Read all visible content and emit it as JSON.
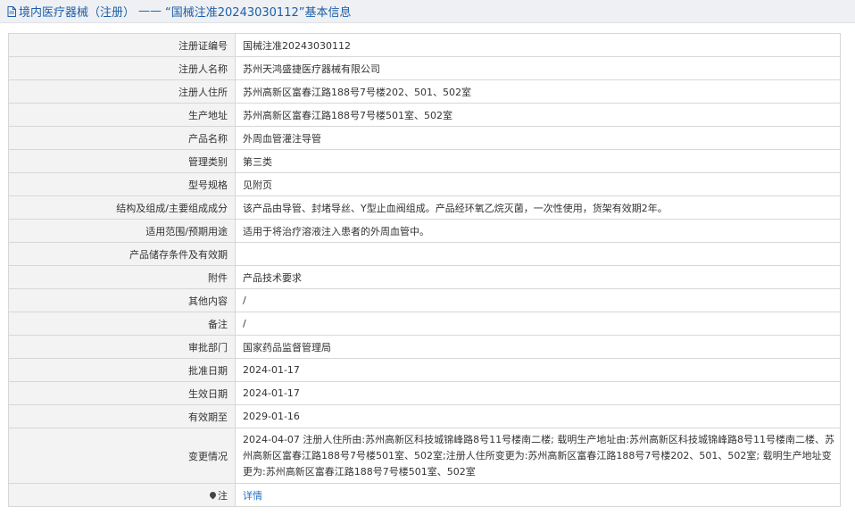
{
  "header": {
    "category": "境内医疗器械（注册）",
    "separator": "——",
    "title": "“国械注准20243030112”基本信息",
    "accent": "#1d5ea8"
  },
  "rows": [
    {
      "label": "注册证编号",
      "value": "国械注准20243030112"
    },
    {
      "label": "注册人名称",
      "value": "苏州天鸿盛捷医疗器械有限公司"
    },
    {
      "label": "注册人住所",
      "value": "苏州高新区富春江路188号7号楼202、501、502室"
    },
    {
      "label": "生产地址",
      "value": "苏州高新区富春江路188号7号楼501室、502室"
    },
    {
      "label": "产品名称",
      "value": "外周血管灌注导管"
    },
    {
      "label": "管理类别",
      "value": "第三类"
    },
    {
      "label": "型号规格",
      "value": "见附页"
    },
    {
      "label": "结构及组成/主要组成成分",
      "value": "该产品由导管、封堵导丝、Y型止血阀组成。产品经环氧乙烷灭菌，一次性使用，货架有效期2年。"
    },
    {
      "label": "适用范围/预期用途",
      "value": "适用于将治疗溶液注入患者的外周血管中。"
    },
    {
      "label": "产品储存条件及有效期",
      "value": ""
    },
    {
      "label": "附件",
      "value": "产品技术要求"
    },
    {
      "label": "其他内容",
      "value": "/"
    },
    {
      "label": "备注",
      "value": "/"
    },
    {
      "label": "审批部门",
      "value": "国家药品监督管理局"
    },
    {
      "label": "批准日期",
      "value": "2024-01-17"
    },
    {
      "label": "生效日期",
      "value": "2024-01-17"
    },
    {
      "label": "有效期至",
      "value": "2029-01-16"
    },
    {
      "label": "变更情况",
      "value": "2024-04-07 注册人住所由:苏州高新区科技城锦峰路8号11号楼南二楼; 载明生产地址由:苏州高新区科技城锦峰路8号11号楼南二楼、苏州高新区富春江路188号7号楼501室、502室;注册人住所变更为:苏州高新区富春江路188号7号楼202、501、502室; 载明生产地址变更为:苏州高新区富春江路188号7号楼501室、502室"
    }
  ],
  "note": {
    "icon": "map-pin-icon",
    "label": "注",
    "link_text": "详情"
  }
}
